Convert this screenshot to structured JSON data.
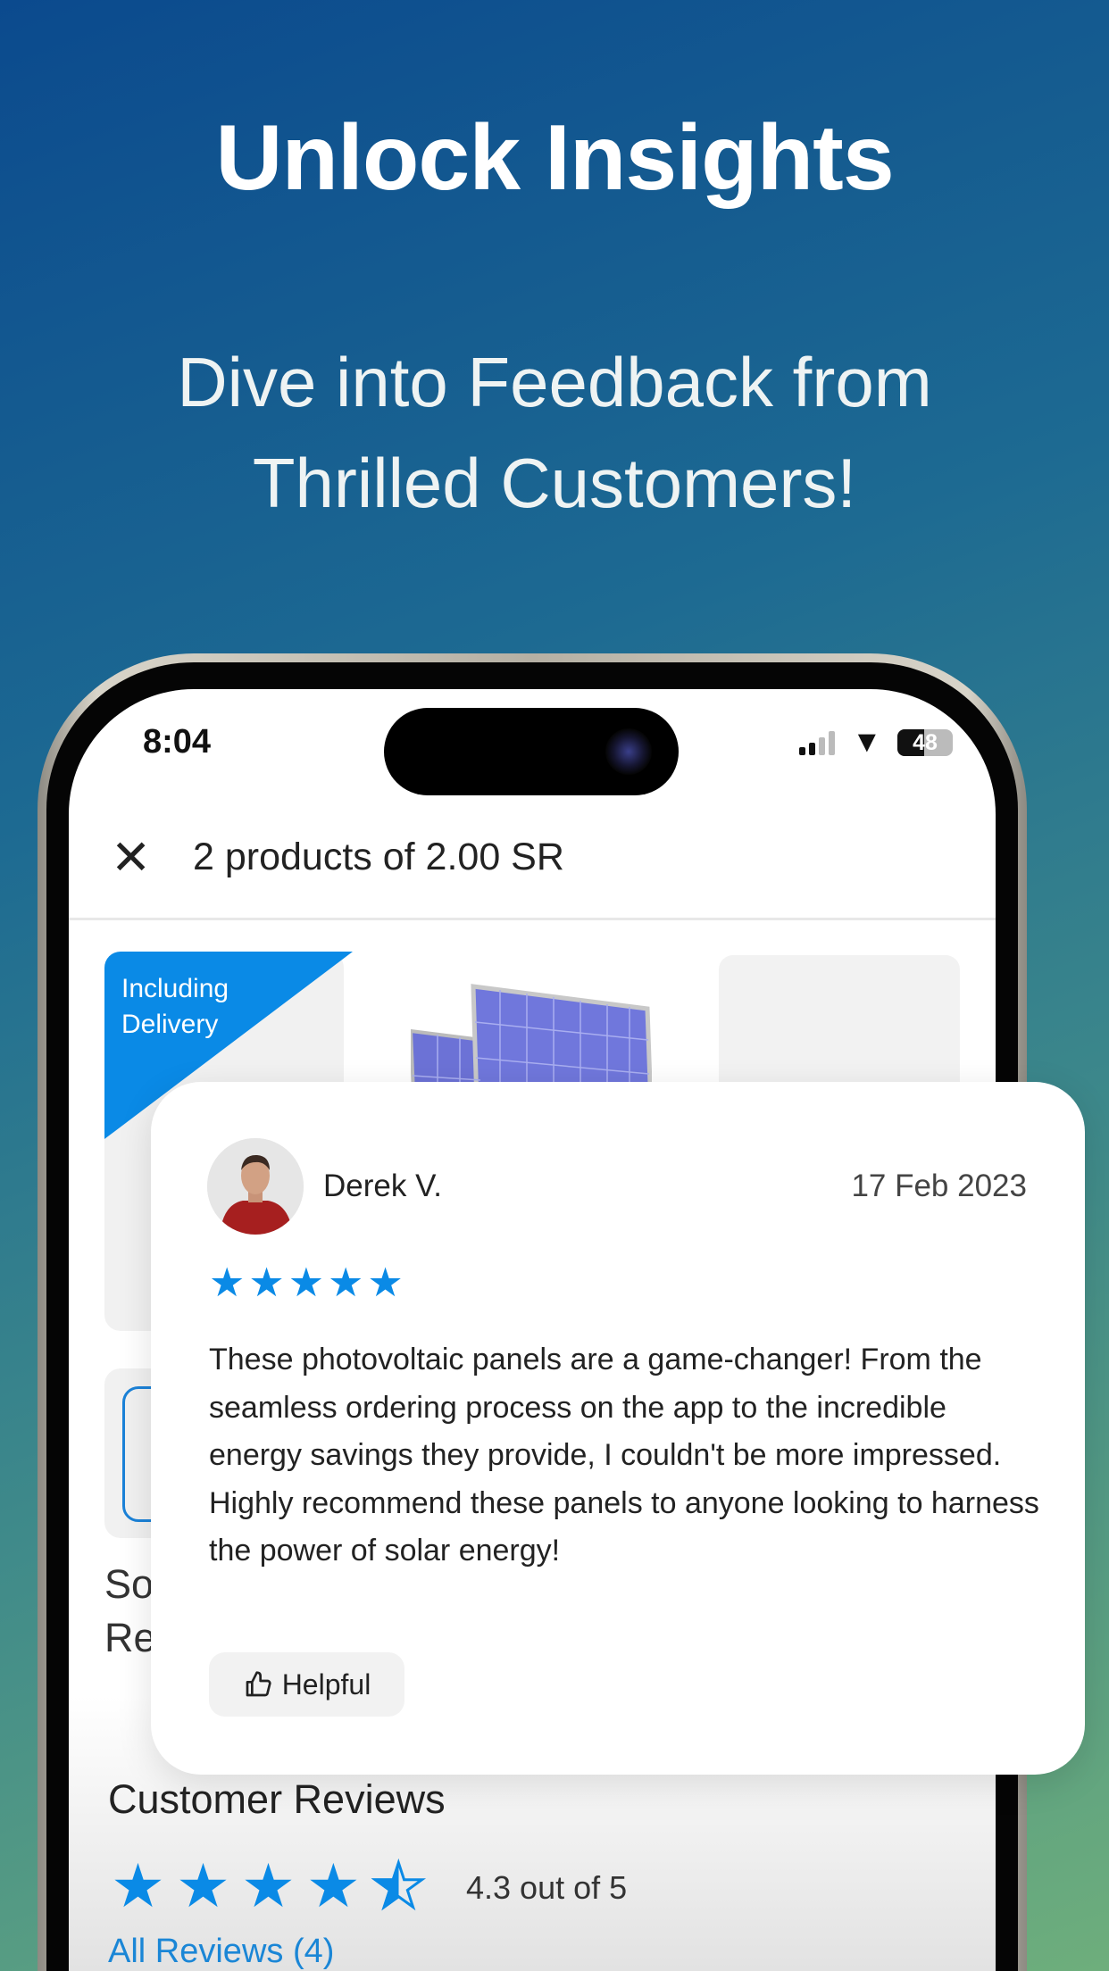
{
  "promo": {
    "headline": "Unlock Insights",
    "subheadline": "Dive into Feedback from\nThrilled Customers!"
  },
  "status_bar": {
    "time": "8:04",
    "battery": "48",
    "battery_level_percent": 48
  },
  "header": {
    "close_icon": "close-icon",
    "title": "2 products of 2.00 SR"
  },
  "product": {
    "badge": "Including\nDelivery",
    "partial_title": "So\nRe"
  },
  "review": {
    "author": "Derek V.",
    "date": "17 Feb 2023",
    "rating": 5,
    "body": "These photovoltaic panels are a game-changer! From the seamless ordering process on the app to the incredible energy savings they provide, I couldn't be more impressed.\nHighly recommend these panels to anyone looking to harness the power of solar energy!",
    "helpful_label": "Helpful"
  },
  "customer_reviews": {
    "title": "Customer Reviews",
    "rating_value": 4.3,
    "rating_text": "4.3 out of 5",
    "all_reviews_link": "All Reviews (4)"
  },
  "colors": {
    "accent": "#0a8ae6",
    "background_top": "#0b4a8e",
    "background_bottom": "#6eae7c"
  }
}
